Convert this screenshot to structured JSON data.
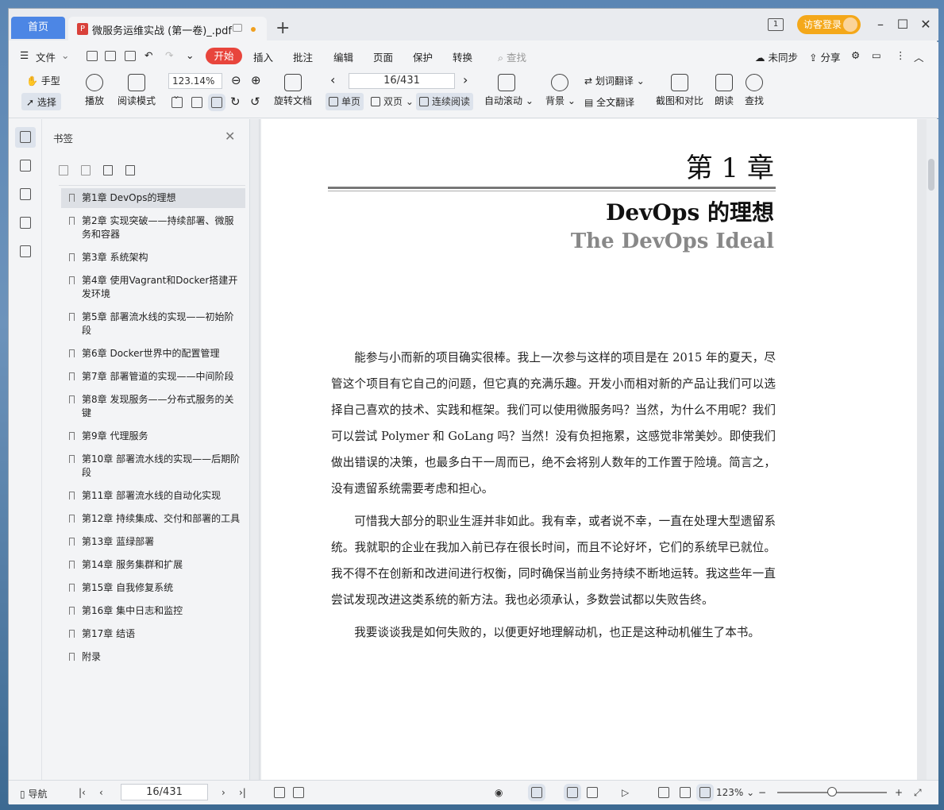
{
  "titlebar": {
    "home_tab": "首页",
    "doc_tab": "微服务运维实战 (第一卷)_.pdf",
    "login": "访客登录"
  },
  "menu": {
    "file": "文件",
    "start": "开始",
    "items": [
      "插入",
      "批注",
      "编辑",
      "页面",
      "保护",
      "转换"
    ],
    "search": "查找",
    "sync": "未同步",
    "share": "分享"
  },
  "toolbar": {
    "hand": "手型",
    "select": "选择",
    "play": "播放",
    "read_mode": "阅读模式",
    "zoom": "123.14%",
    "rotate": "旋转文档",
    "page_indicator": "16/431",
    "single": "单页",
    "double": "双页",
    "continuous": "连续阅读",
    "auto_scroll": "自动滚动",
    "background": "背景",
    "word_translate": "划词翻译",
    "full_translate": "全文翻译",
    "screenshot_compare": "截图和对比",
    "read_aloud": "朗读",
    "find": "查找"
  },
  "sidebar": {
    "title": "书签",
    "bookmarks": [
      "第1章  DevOps的理想",
      "第2章  实现突破——持续部署、微服务和容器",
      "第3章  系统架构",
      "第4章  使用Vagrant和Docker搭建开发环境",
      "第5章  部署流水线的实现——初始阶段",
      "第6章  Docker世界中的配置管理",
      "第7章  部署管道的实现——中间阶段",
      "第8章  发现服务——分布式服务的关键",
      "第9章  代理服务",
      "第10章  部署流水线的实现——后期阶段",
      "第11章  部署流水线的自动化实现",
      "第12章  持续集成、交付和部署的工具",
      "第13章  蓝绿部署",
      "第14章  服务集群和扩展",
      "第15章  自我修复系统",
      "第16章  集中日志和监控",
      "第17章  结语",
      "附录"
    ]
  },
  "document": {
    "chapter": "第 1 章",
    "title_cn": "DevOps 的理想",
    "title_en": "The DevOps Ideal",
    "paragraphs": [
      "能参与小而新的项目确实很棒。我上一次参与这样的项目是在 2015 年的夏天，尽管这个项目有它自己的问题，但它真的充满乐趣。开发小而相对新的产品让我们可以选择自己喜欢的技术、实践和框架。我们可以使用微服务吗？当然，为什么不用呢？我们可以尝试 Polymer 和 GoLang 吗？当然！没有负担拖累，这感觉非常美妙。即使我们做出错误的决策，也最多白干一周而已，绝不会将别人数年的工作置于险境。简言之，没有遗留系统需要考虑和担心。",
      "可惜我大部分的职业生涯并非如此。我有幸，或者说不幸，一直在处理大型遗留系统。我就职的企业在我加入前已存在很长时间，而且不论好坏，它们的系统早已就位。我不得不在创新和改进间进行权衡，同时确保当前业务持续不断地运转。我这些年一直尝试发现改进这类系统的新方法。我也必须承认，多数尝试都以失败告终。",
      "我要谈谈我是如何失败的，以便更好地理解动机，也正是这种动机催生了本书。"
    ]
  },
  "statusbar": {
    "nav": "导航",
    "page": "16/431",
    "zoom": "123%",
    "zoom_fraction": 0.5
  }
}
